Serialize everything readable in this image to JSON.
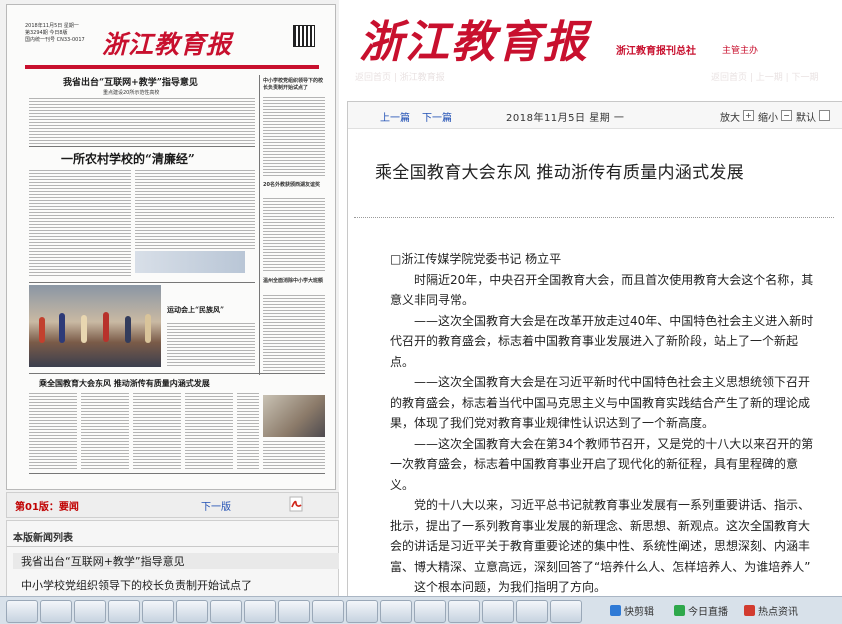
{
  "left_pane": {
    "newspaper_thumb": {
      "masthead": "浙江教育报",
      "meta_lines": [
        "2018年11月5日 星期一",
        "第3294期 今日8版",
        "国内统一刊号 CN33-0017"
      ],
      "headlines": {
        "lead": "我省出台“互联网+教学”指导意见",
        "lead_sub": "重点建设20所示范性高校",
        "side1": "中小学校党组织领导下的校长负责制开始试点了",
        "rural": "一所农村学校的“清廉经”",
        "sports": "运动会上“民族风”",
        "bottom": "乘全国教育大会东风  推动浙传有质量内涵式发展",
        "side2": "20名外教获颁西湖友谊奖",
        "side3": "温州全面消除中小学大班额"
      }
    },
    "pager": {
      "current_page": "第01版：要闻",
      "next_page": "下一版",
      "pdf_icon": "pdf-icon"
    },
    "news_list": {
      "title": "本版新闻列表",
      "items": [
        "我省出台“互联网+教学”指导意见",
        "中小学校党组织领导下的校长负责制开始试点了"
      ]
    }
  },
  "right_pane": {
    "masthead": "浙江教育报",
    "publisher": "浙江教育报刊总社",
    "sponsor": "主管主办",
    "faint_nav_left": "返回首页 | 浙江教育报",
    "faint_nav_right": "返回首页 | 上一期 | 下一期",
    "toolbar": {
      "prev": "上一篇",
      "next": "下一篇",
      "date": "2018年11月5日  星期 一",
      "zoom_in": "放大",
      "zoom_out": "缩小",
      "reset": "默认"
    },
    "article": {
      "title": "乘全国教育大会东风 推动浙传有质量内涵式发展",
      "author": "□浙江传媒学院党委书记 杨立平",
      "paragraphs": [
        "时隔近20年，中央召开全国教育大会，而且首次使用教育大会这个名称，其意义非同寻常。",
        "——这次全国教育大会是在改革开放走过40年、中国特色社会主义进入新时代召开的教育盛会，标志着中国教育事业发展进入了新阶段，站上了一个新起点。",
        "——这次全国教育大会是在习近平新时代中国特色社会主义思想统领下召开的教育盛会，标志着当代中国马克思主义与中国教育实践结合产生了新的理论成果，体现了我们党对教育事业规律性认识达到了一个新高度。",
        "——这次全国教育大会在第34个教师节召开，又是党的十八大以来召开的第一次教育盛会，标志着中国教育事业开启了现代化的新征程，具有里程碑的意义。",
        "党的十八大以来，习近平总书记就教育事业发展有一系列重要讲话、指示、批示，提出了一系列教育事业发展的新理念、新思想、新观点。这次全国教育大会的讲话是习近平关于教育重要论述的集中性、系统性阐述，思想深刻、内涵丰富、博大精深、立意高远，深刻回答了“培养什么人、怎样培养人、为谁培养人”",
        "这个根本问题，为我们指明了方向。"
      ]
    }
  },
  "taskbar": {
    "tray": [
      {
        "label": "快剪辑",
        "icon": "scissors-icon",
        "color": "#2f7ad6"
      },
      {
        "label": "今日直播",
        "icon": "live-icon",
        "color": "#2ea84b"
      },
      {
        "label": "热点资讯",
        "icon": "news-icon",
        "color": "#d23b2f"
      }
    ]
  }
}
